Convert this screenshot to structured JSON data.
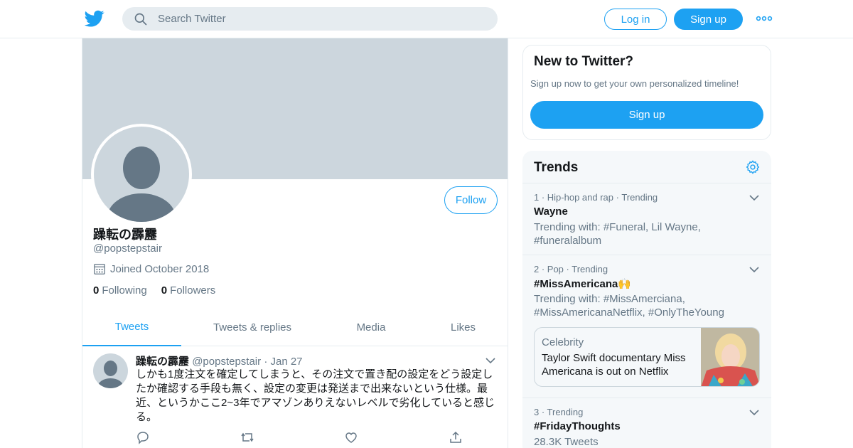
{
  "colors": {
    "brand": "#1da1f2",
    "text": "#14171a",
    "secondary": "#657786",
    "banner": "#ccd6dd",
    "border": "#e6ecf0"
  },
  "header": {
    "logo_icon": "twitter-bird-icon",
    "search": {
      "placeholder": "Search Twitter",
      "value": ""
    },
    "login_label": "Log in",
    "signup_label": "Sign up",
    "more_icon": "more-dots-icon"
  },
  "profile": {
    "display_name": "躁転の霹靂",
    "handle": "@popstepstair",
    "joined": "Joined October 2018",
    "following_count": "0",
    "following_label": "Following",
    "followers_count": "0",
    "followers_label": "Followers",
    "follow_label": "Follow"
  },
  "tabs": [
    {
      "label": "Tweets",
      "active": true
    },
    {
      "label": "Tweets & replies",
      "active": false
    },
    {
      "label": "Media",
      "active": false
    },
    {
      "label": "Likes",
      "active": false
    }
  ],
  "tweet": {
    "name": "躁転の霹靂",
    "handle": "@popstepstair",
    "separator": "·",
    "date": "Jan 27",
    "text": "しかも1度注文を確定してしまうと、その注文で置き配の設定をどう設定したか確認する手段も無く、設定の変更は発送まで出来ないという仕様。最近、というかここ2~3年でアマゾンありえないレベルで劣化していると感じる。"
  },
  "new_to_twitter": {
    "title": "New to Twitter?",
    "subtitle": "Sign up now to get your own personalized timeline!",
    "button": "Sign up"
  },
  "trends": {
    "title": "Trends",
    "items": [
      {
        "meta": "1 · Hip-hop and rap · Trending",
        "name": "Wayne",
        "desc": "Trending with: #Funeral, Lil Wayne, #funeralalbum"
      },
      {
        "meta": "2 · Pop · Trending",
        "name": "#MissAmericana🙌",
        "desc": "Trending with: #MissAmerciana, #MissAmericanaNetflix, #OnlyTheYoung"
      },
      {
        "meta": "3 · Trending",
        "name": "#FridayThoughts",
        "desc": "28.3K Tweets"
      }
    ],
    "card": {
      "category": "Celebrity",
      "text": "Taylor Swift documentary Miss Americana is out on Netflix"
    }
  }
}
